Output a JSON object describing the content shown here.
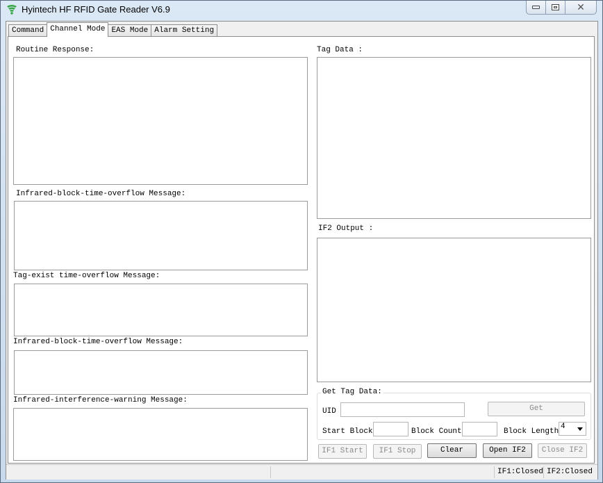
{
  "window": {
    "title": "Hyintech HF RFID Gate Reader V6.9",
    "icon": "wifi-signal-icon",
    "controls": {
      "minimize": "minimize-icon",
      "maximize": "maximize-icon",
      "close": "close-icon"
    }
  },
  "tabs": [
    {
      "label": "Command",
      "active": false
    },
    {
      "label": "Channel Mode",
      "active": true
    },
    {
      "label": "EAS Mode",
      "active": false
    },
    {
      "label": "Alarm Setting",
      "active": false
    }
  ],
  "left": {
    "routine_response_label": "Routine Response:",
    "infrared_block_label_1": "Infrared-block-time-overflow Message:",
    "tag_exist_label": "Tag-exist time-overflow Message:",
    "infrared_block_label_2": "Infrared-block-time-overflow Message:",
    "infrared_interference_label": "Infrared-interference-warning Message:"
  },
  "right": {
    "tag_data_label": "Tag Data :",
    "if2_output_label": "IF2 Output :"
  },
  "get_tag_data": {
    "title": "Get Tag Data:",
    "uid_label": "UID",
    "uid_value": "",
    "get_button": "Get",
    "start_block_label": "Start Block",
    "start_block_value": "",
    "block_count_label": "Block Count:",
    "block_count_value": "",
    "block_length_label": "Block Length:",
    "block_length_value": "4"
  },
  "buttons": {
    "if1_start": "IF1 Start",
    "if1_stop": "IF1 Stop",
    "clear": "Clear",
    "open_if2": "Open IF2",
    "close_if2": "Close IF2"
  },
  "status": {
    "if1": "IF1:Closed",
    "if2": "IF2:Closed"
  }
}
